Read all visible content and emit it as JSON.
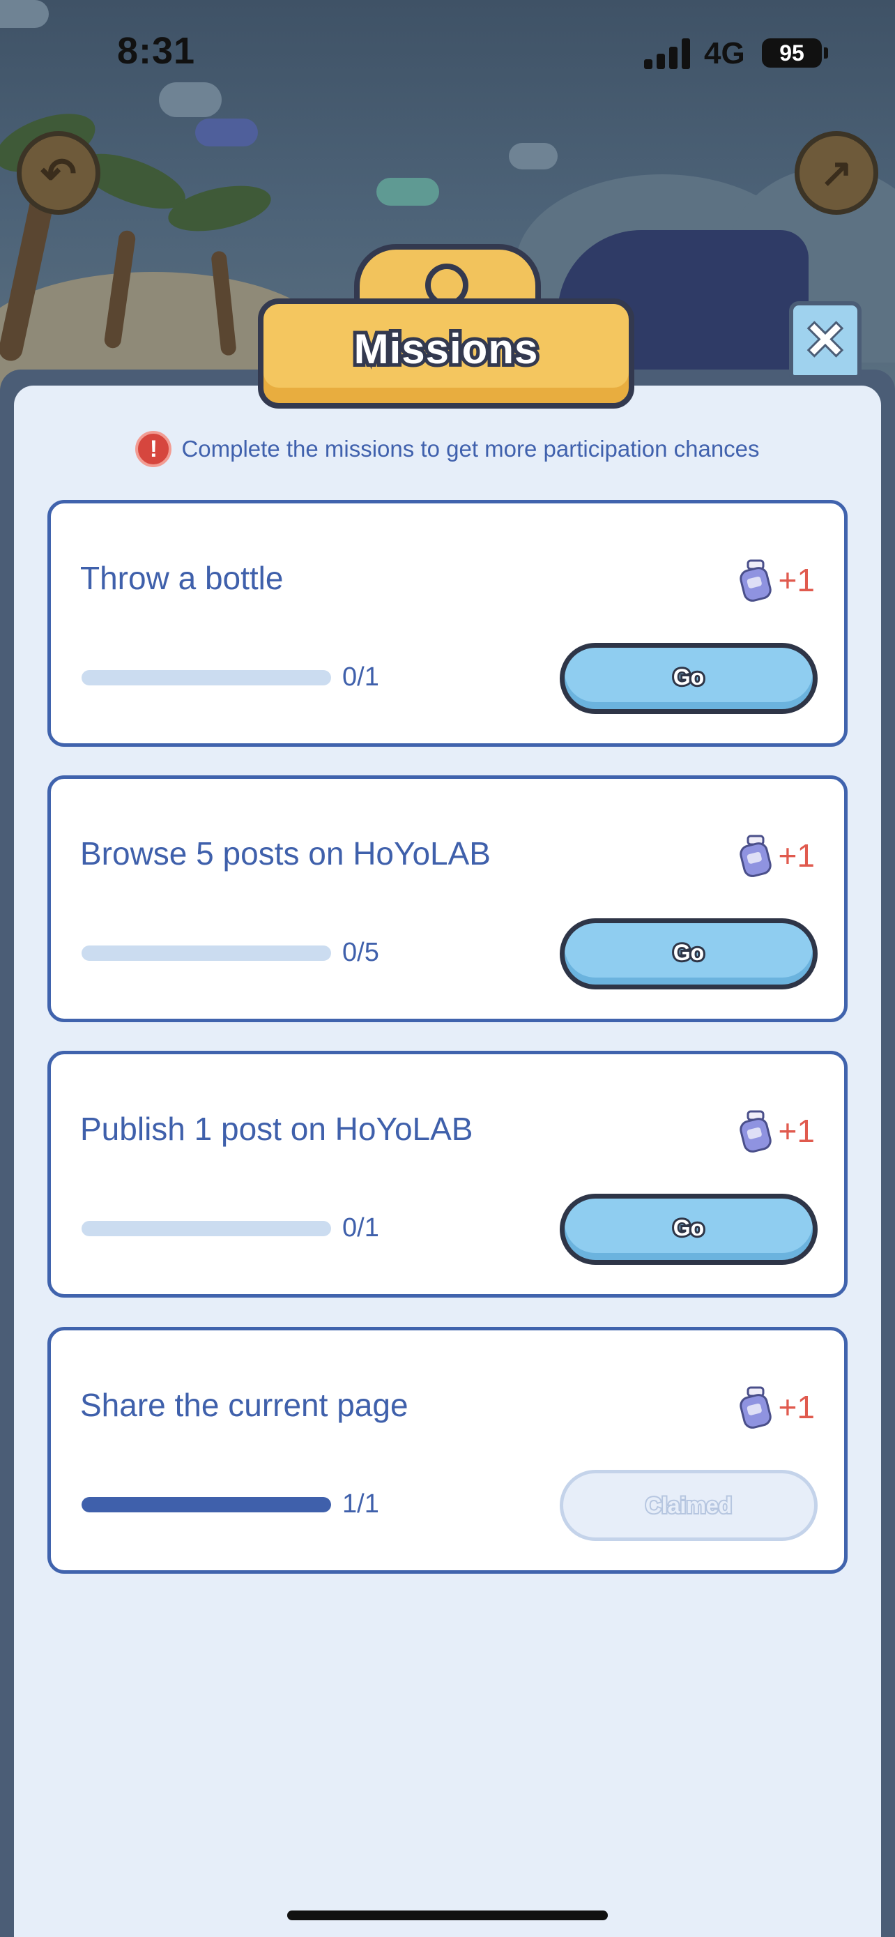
{
  "status_bar": {
    "time": "8:31",
    "network": "4G",
    "battery": "95"
  },
  "panel": {
    "title": "Missions",
    "notice": "Complete the missions to get more participation chances"
  },
  "missions": [
    {
      "title": "Throw a bottle",
      "reward": "+1",
      "progress_text": "0/1",
      "progress_fraction": 0,
      "button": "Go",
      "state": "go"
    },
    {
      "title": "Browse 5 posts on HoYoLAB",
      "reward": "+1",
      "progress_text": "0/5",
      "progress_fraction": 0,
      "button": "Go",
      "state": "go"
    },
    {
      "title": "Publish 1 post on HoYoLAB",
      "reward": "+1",
      "progress_text": "0/1",
      "progress_fraction": 0,
      "button": "Go",
      "state": "go"
    },
    {
      "title": "Share the current page",
      "reward": "+1",
      "progress_text": "1/1",
      "progress_fraction": 1,
      "button": "Claimed",
      "state": "claimed"
    }
  ],
  "colors": {
    "accent_blue": "#3f60ab",
    "reward_red": "#e05a4e",
    "go_button": "#8fcdf0",
    "plaque_yellow": "#f4c65f"
  },
  "icons": {
    "back": "back-arrow-icon",
    "share": "share-icon",
    "close": "close-icon",
    "notice": "exclamation-icon",
    "reward": "bottle-icon"
  }
}
